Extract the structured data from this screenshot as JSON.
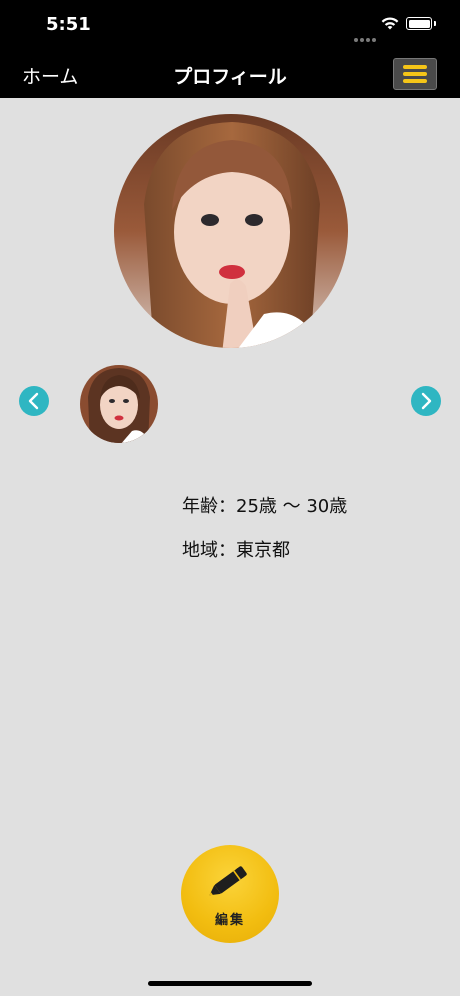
{
  "status_bar": {
    "time": "5:51"
  },
  "nav": {
    "back_label": "ホーム",
    "title": "プロフィール",
    "menu_icon": "hamburger-menu-icon"
  },
  "profile": {
    "main_photo": "profile-photo",
    "thumbnails": [
      "profile-thumbnail"
    ],
    "age_label": "年齢",
    "separator": "：",
    "age_value": "25歳 〜 30歳",
    "region_label": "地域",
    "region_value": "東京都"
  },
  "edit": {
    "label": "編集",
    "icon": "pencil-icon"
  },
  "colors": {
    "background": "#e0e0e0",
    "bar": "#000000",
    "accent": "#f2bd10",
    "arrow": "#2fb6c2"
  }
}
